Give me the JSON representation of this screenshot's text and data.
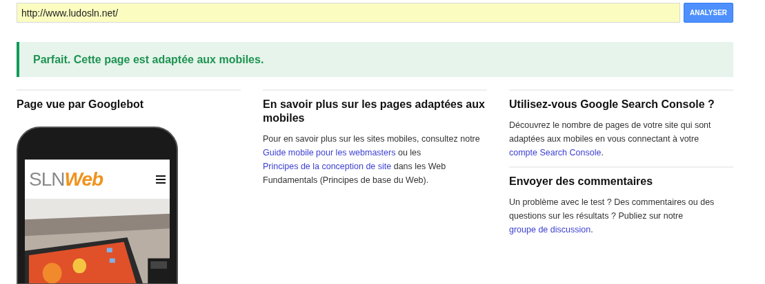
{
  "url_field": {
    "value": "http://www.ludosln.net/"
  },
  "analyze_button": "ANALYSER",
  "result_banner": {
    "kind": "success",
    "message": "Parfait. Cette page est adaptée aux mobiles."
  },
  "columns": [
    {
      "sections": [
        {
          "heading": "Page vue par Googlebot",
          "preview": {
            "logo_left": "SLN",
            "logo_right": "Web"
          }
        }
      ]
    },
    {
      "sections": [
        {
          "heading": "En savoir plus sur les pages adaptées aux mobiles",
          "paragraph": [
            {
              "text": "Pour en savoir plus sur les sites mobiles, consultez notre ",
              "link": false
            },
            {
              "text": "Guide mobile pour les webmasters",
              "link": true
            },
            {
              "text": " ou les ",
              "link": false
            },
            {
              "text": "Principes de la conception de site",
              "link": true
            },
            {
              "text": " dans les Web Fundamentals (Principes de base du Web).",
              "link": false
            }
          ]
        }
      ]
    },
    {
      "sections": [
        {
          "heading": "Utilisez-vous Google Search Console ?",
          "paragraph": [
            {
              "text": "Découvrez le nombre de pages de votre site qui sont adaptées aux mobiles en vous connectant à votre ",
              "link": false
            },
            {
              "text": "compte Search Console",
              "link": true
            },
            {
              "text": ".",
              "link": false
            }
          ]
        },
        {
          "heading": "Envoyer des commentaires",
          "paragraph": [
            {
              "text": "Un problème avec le test ? Des commentaires ou des questions sur les résultats ? Publiez sur notre ",
              "link": false
            },
            {
              "text": "groupe de discussion",
              "link": true
            },
            {
              "text": ".",
              "link": false
            }
          ]
        }
      ]
    }
  ]
}
